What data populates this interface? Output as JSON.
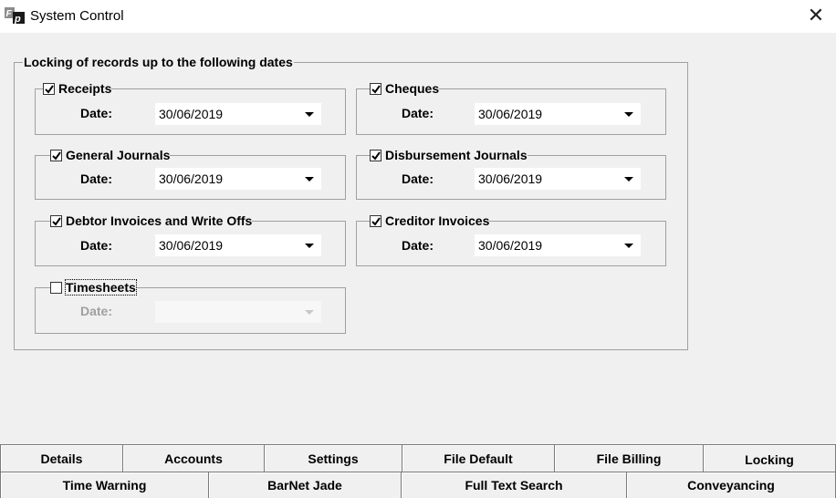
{
  "window": {
    "title": "System Control",
    "close_glyph": "✕"
  },
  "locking": {
    "group_title": "Locking of records up to the following dates",
    "date_label": "Date:",
    "sections": [
      {
        "label": "Receipts",
        "checked": true,
        "date": "30/06/2019"
      },
      {
        "label": "Cheques",
        "checked": true,
        "date": "30/06/2019"
      },
      {
        "label": "General Journals",
        "checked": true,
        "date": "30/06/2019"
      },
      {
        "label": "Disbursement Journals",
        "checked": true,
        "date": "30/06/2019"
      },
      {
        "label": "Debtor Invoices and Write Offs",
        "checked": true,
        "date": "30/06/2019"
      },
      {
        "label": "Creditor Invoices",
        "checked": true,
        "date": "30/06/2019"
      },
      {
        "label": "Timesheets",
        "checked": false,
        "date": ""
      }
    ]
  },
  "tabs": {
    "row1": [
      "Details",
      "Accounts",
      "Settings",
      "File Default",
      "File Billing",
      "Locking"
    ],
    "row2": [
      "Time Warning",
      "BarNet Jade",
      "Full Text Search",
      "Conveyancing"
    ],
    "selected": "Locking"
  },
  "icons": {
    "app": "app-logo-icon",
    "close": "close-icon",
    "check": "checkmark-icon",
    "dropdown": "dropdown-arrow-icon"
  }
}
